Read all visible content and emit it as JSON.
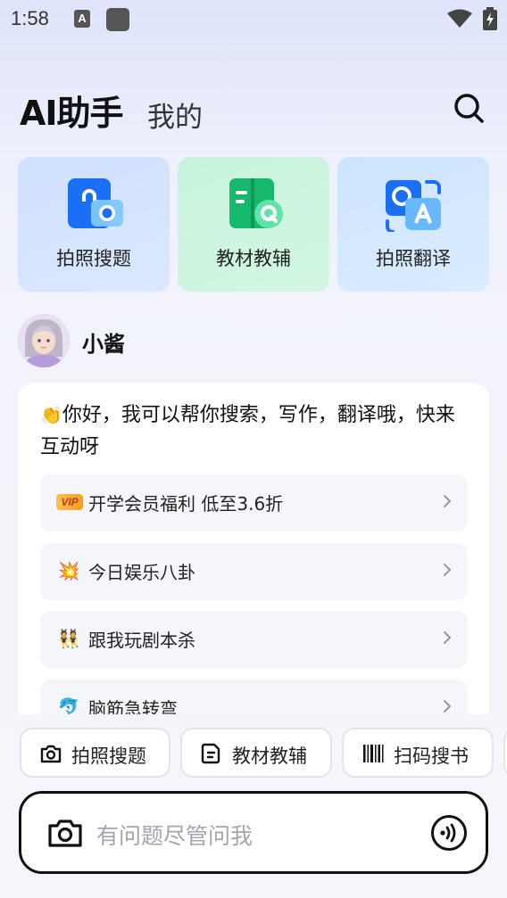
{
  "status_bar": {
    "time": "1:58",
    "a_icon_text": "A",
    "icons": [
      "a-app-icon",
      "app-square-icon",
      "wifi-icon",
      "battery-charging-icon"
    ]
  },
  "header": {
    "tab_active": "AI助手",
    "tab_inactive": "我的",
    "search_icon": "search-icon"
  },
  "quick_cards": [
    {
      "label": "拍照搜题",
      "icon": "photo-search-icon"
    },
    {
      "label": "教材教辅",
      "icon": "textbook-icon"
    },
    {
      "label": "拍照翻译",
      "icon": "photo-translate-icon"
    }
  ],
  "assistant": {
    "name": "小酱",
    "greeting_emoji": "👏",
    "greeting": "你好，我可以帮你搜索，写作，翻译哦，快来互动呀"
  },
  "suggestions": [
    {
      "badge": "VIP",
      "text": "开学会员福利 低至3.6折"
    },
    {
      "emoji": "💥",
      "text": "今日娱乐八卦"
    },
    {
      "emoji": "👯",
      "text": "跟我玩剧本杀"
    },
    {
      "emoji": "🐬",
      "text": "脑筋急转弯"
    }
  ],
  "chips": [
    {
      "label": "拍照搜题",
      "icon": "camera-icon"
    },
    {
      "label": "教材教辅",
      "icon": "document-icon"
    },
    {
      "label": "扫码搜书",
      "icon": "barcode-icon"
    }
  ],
  "input": {
    "placeholder": "有问题尽管问我",
    "camera_icon": "camera-icon",
    "voice_icon": "voice-icon"
  },
  "colors": {
    "card_blue": "#cfe0fe",
    "card_green": "#c6f3dc",
    "icon_blue": "#1a73f5",
    "icon_green": "#1ec77a",
    "input_border": "#111111"
  }
}
